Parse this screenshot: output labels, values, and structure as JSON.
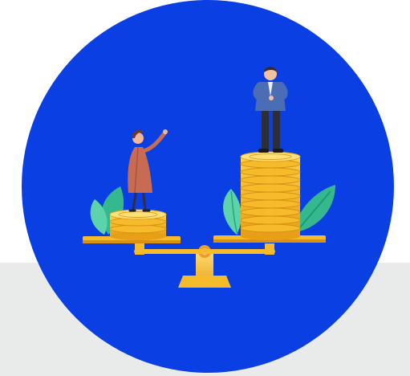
{
  "illustration": {
    "subject": "pay-gap-scale",
    "colors": {
      "circle": "#0a3fe3",
      "bottom_band": "#e8ebea",
      "gold": "#f6bb2a",
      "gold_light": "#fde07a",
      "gold_dark": "#d99112",
      "leaf": "#3cc39a",
      "woman_dress": "#c96a52",
      "man_suit": "#4a6db5"
    }
  }
}
